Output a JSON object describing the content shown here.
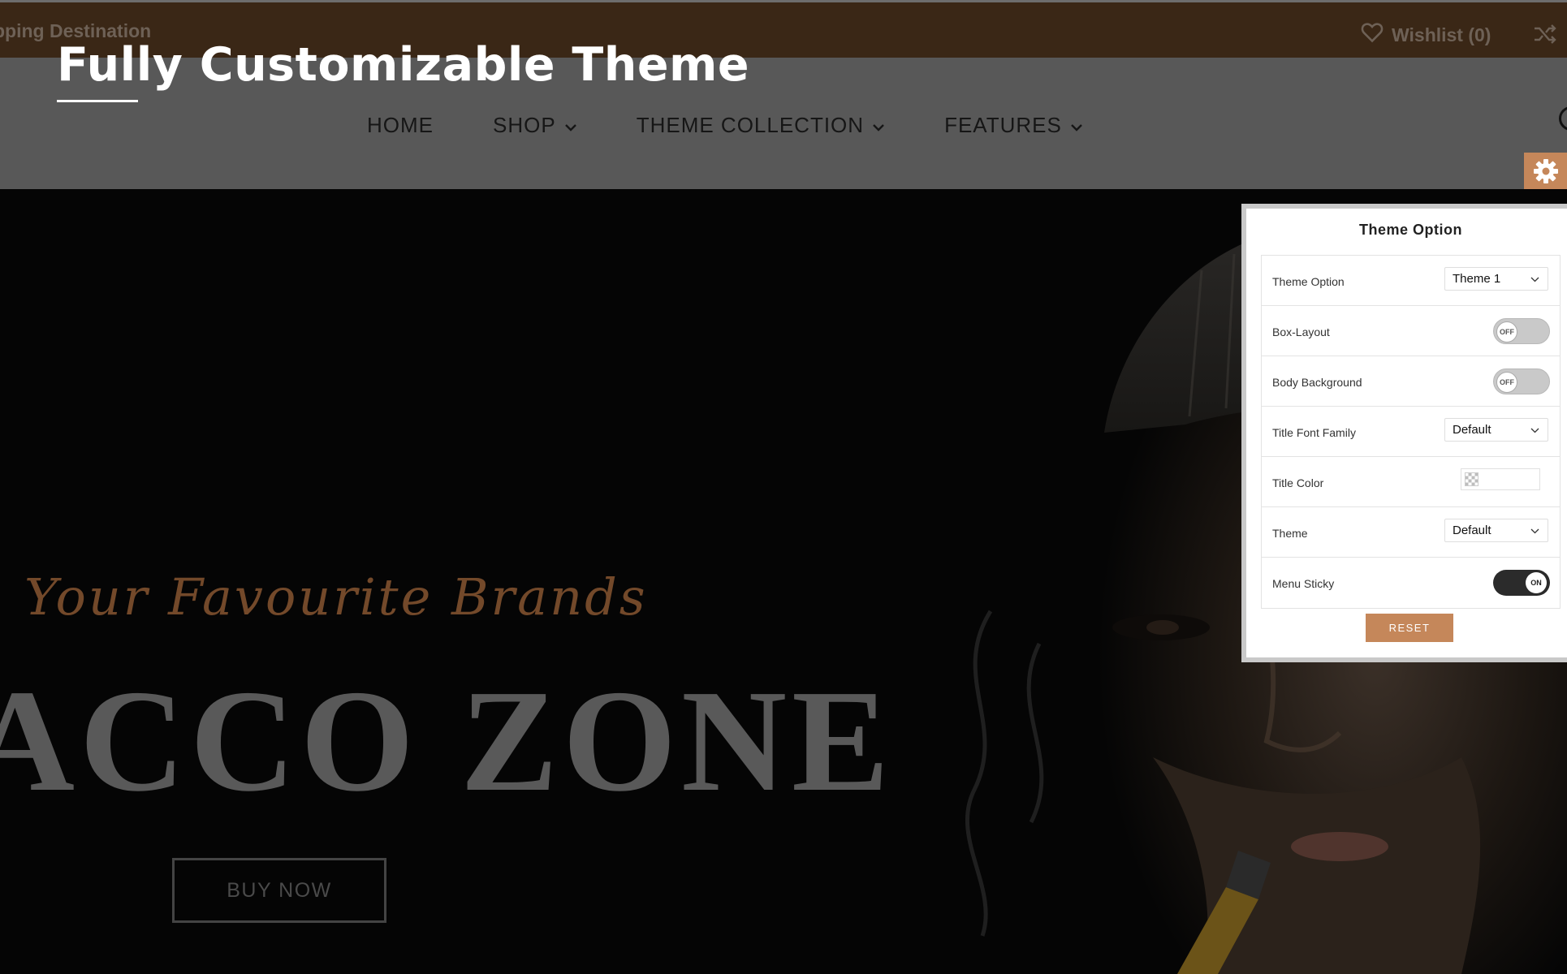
{
  "topbar": {
    "promo_text": "pping Destination",
    "wishlist_label": "Wishlist (0)"
  },
  "header": {
    "headline": "Fully Customizable Theme",
    "nav": [
      {
        "label": "HOME",
        "has_dropdown": false
      },
      {
        "label": "SHOP",
        "has_dropdown": true
      },
      {
        "label": "THEME COLLECTION",
        "has_dropdown": true
      },
      {
        "label": "FEATURES",
        "has_dropdown": true
      }
    ]
  },
  "hero": {
    "script_line": "Your Favourite Brands",
    "big_title": "ACCO ZONE",
    "cta_label": "BUY NOW"
  },
  "theme_panel": {
    "title": "Theme Option",
    "rows": {
      "theme_option": {
        "label": "Theme Option",
        "value": "Theme 1"
      },
      "box_layout": {
        "label": "Box-Layout",
        "state": "OFF"
      },
      "body_background": {
        "label": "Body Background",
        "state": "OFF"
      },
      "title_font_family": {
        "label": "Title Font Family",
        "value": "Default"
      },
      "title_color": {
        "label": "Title Color"
      },
      "theme": {
        "label": "Theme",
        "value": "Default"
      },
      "menu_sticky": {
        "label": "Menu Sticky",
        "state": "ON"
      }
    },
    "reset_label": "RESET"
  },
  "colors": {
    "accent": "#c5875a",
    "topbar_bg": "#3a2716",
    "header_bg": "#585858",
    "hero_bg": "#050505"
  },
  "icons": [
    "heart-icon",
    "shuffle-icon",
    "chevron-down-icon",
    "gear-icon",
    "search-icon"
  ]
}
